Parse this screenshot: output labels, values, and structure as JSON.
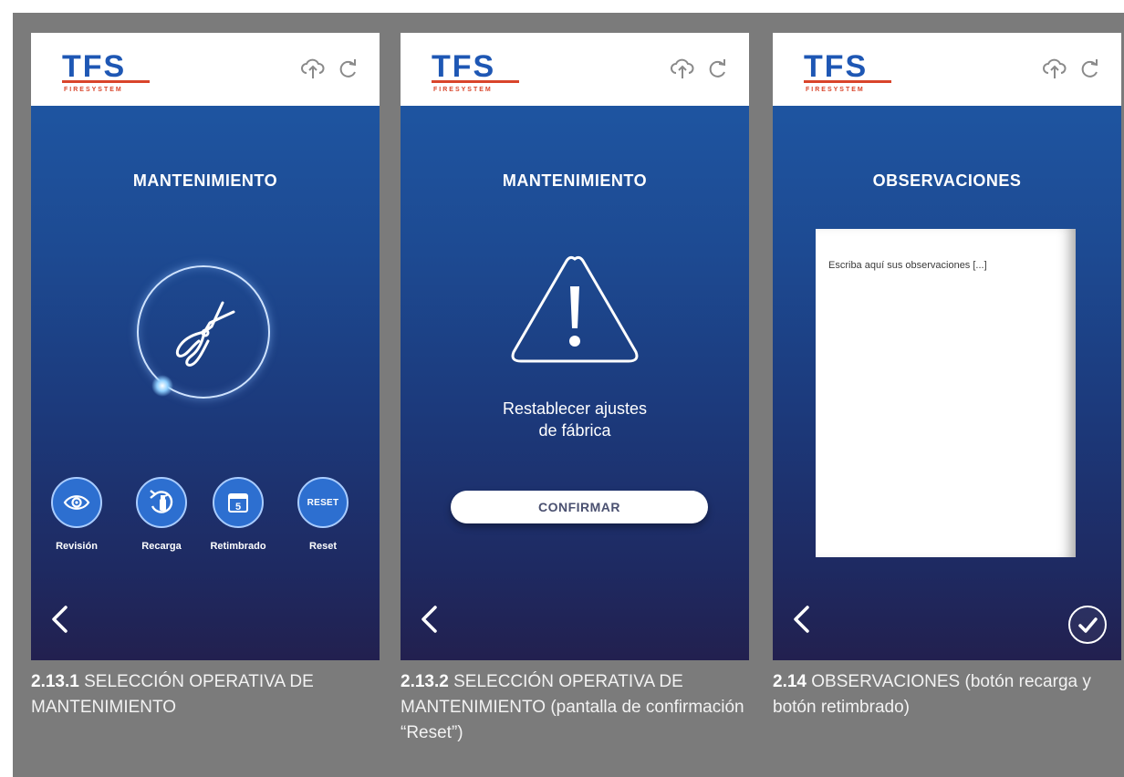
{
  "brand": {
    "logo_text": "TFS",
    "logo_subtext": "FIRESYSTEM"
  },
  "colors": {
    "header_bg": "#ffffff",
    "screen_gradient_top": "#1f5aa8",
    "screen_gradient_bottom": "#22204f",
    "accent_red": "#d9452b",
    "logo_blue": "#1e57b4",
    "button_blue": "#2d6fd0"
  },
  "header_icons": [
    "cloud-upload-icon",
    "refresh-icon"
  ],
  "screen1": {
    "title": "MANTENIMIENTO",
    "center_icon": "pliers-icon",
    "actions": [
      {
        "label": "Revisión",
        "icon": "eye-icon"
      },
      {
        "label": "Recarga",
        "icon": "extinguisher-refill-icon"
      },
      {
        "label": "Retimbrado",
        "icon": "calendar-icon",
        "icon_text": "5"
      },
      {
        "label": "Reset",
        "icon": "reset-icon",
        "icon_text": "RESET"
      }
    ],
    "back_icon": "chevron-left-icon"
  },
  "screen2": {
    "title": "MANTENIMIENTO",
    "warning_icon": "warning-triangle-icon",
    "message_line1": "Restablecer ajustes",
    "message_line2": "de fábrica",
    "confirm_label": "CONFIRMAR",
    "back_icon": "chevron-left-icon"
  },
  "screen3": {
    "title": "OBSERVACIONES",
    "textarea_placeholder": "Escriba aquí sus observaciones [...]",
    "back_icon": "chevron-left-icon",
    "confirm_icon": "checkmark-circle-icon"
  },
  "captions": [
    {
      "number": "2.13.1",
      "text": "SELECCIÓN OPERATIVA DE MANTENIMIENTO"
    },
    {
      "number": "2.13.2",
      "text": "SELECCIÓN OPERATIVA DE MANTENIMIENTO (pantalla de confirmación “Reset”)"
    },
    {
      "number": "2.14",
      "text": "OBSERVACIONES (botón recarga y botón retimbrado)"
    }
  ]
}
